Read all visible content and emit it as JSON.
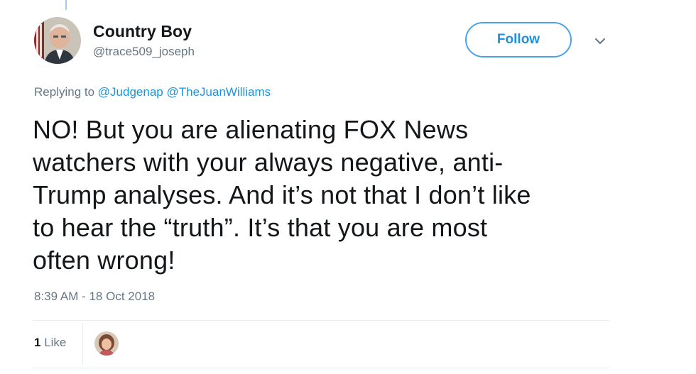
{
  "author": {
    "display_name": "Country Boy",
    "handle": "@trace509_joseph",
    "avatar_icon": "profile-photo-man-with-flag"
  },
  "follow_button": {
    "label": "Follow"
  },
  "menu": {
    "icon": "chevron-down-icon"
  },
  "reply_context": {
    "prefix": "Replying to",
    "mentions": [
      "@Judgenap",
      "@TheJuanWilliams"
    ]
  },
  "tweet": {
    "lines": [
      "NO! But you are alienating FOX News",
      "watchers with your always negative, anti-",
      "Trump analyses. And it’s not that I don’t like",
      "to hear the “truth”. It’s that you are most",
      "often wrong!"
    ]
  },
  "timestamp": "8:39 AM - 18 Oct 2018",
  "stats": {
    "like_count": "1",
    "like_label": "Like"
  },
  "colors": {
    "accent": "#1b95e0",
    "text": "#14171a",
    "secondary": "#657786"
  }
}
